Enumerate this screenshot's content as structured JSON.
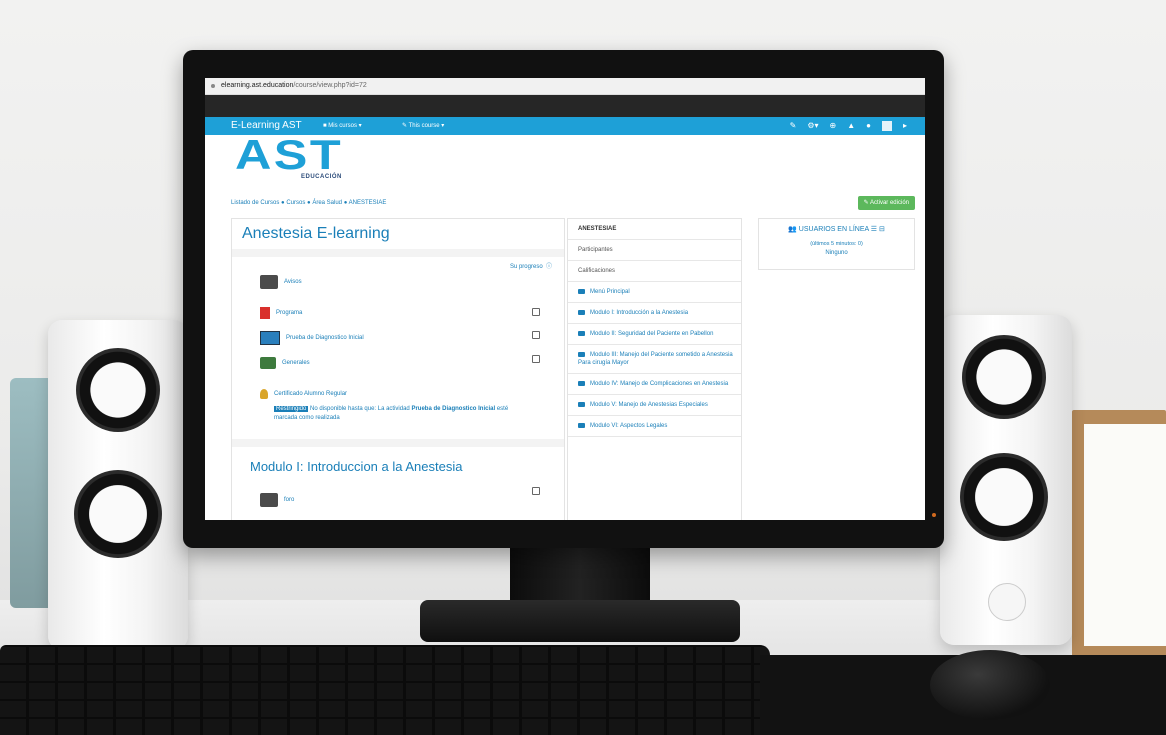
{
  "browser": {
    "url_host": "elearning.ast.education",
    "url_path": "/course/view.php?id=72"
  },
  "navbar": {
    "brand": "E-Learning AST",
    "menu_my_courses": "Mis cursos",
    "menu_this_course": "This course",
    "icons": [
      "edit-icon",
      "settings-icon",
      "globe-icon",
      "bell-icon",
      "chat-icon",
      "avatar",
      "caret-icon"
    ]
  },
  "logo": {
    "text": "AST",
    "sub": "EDUCACIÓN"
  },
  "breadcrumb": [
    "Listado de Cursos",
    "Cursos",
    "Área Salud",
    "ANESTESIAE"
  ],
  "edit_button": "Activar edición",
  "course": {
    "title": "Anestesia E-learning",
    "progress_label": "Su progreso",
    "activities": [
      {
        "label": "Avisos",
        "icon": "forum-icon",
        "checkbox": false
      },
      {
        "label": "Programa",
        "icon": "pdf-icon",
        "checkbox": true
      },
      {
        "label": "Prueba de Diagnostico Inicial",
        "icon": "quiz-icon",
        "checkbox": true
      },
      {
        "label": "Generales",
        "icon": "forum-icon",
        "checkbox": true
      },
      {
        "label": "Certificado Alumno Regular",
        "icon": "certificate-icon",
        "checkbox": false
      }
    ],
    "restriction": {
      "tag": "Restringido",
      "pre": "No disponible hasta que: La actividad",
      "bold": "Prueba de Diagnostico Inicial",
      "post": "esté marcada como realizada"
    },
    "section2_title": "Modulo I: Introduccion a la Anestesia",
    "section2_first": "foro"
  },
  "nav_block": {
    "header": "ANESTESIAE",
    "items": [
      "Participantes",
      "Calificaciones"
    ],
    "modules": [
      "Menú Principal",
      "Modulo I: Introducción a la Anestesia",
      "Modulo II: Seguridad del Paciente en Pabellon",
      "Modulo III: Manejo del Paciente sometido a Anestesia Para cirugía Mayor",
      "Modulo IV: Manejo de Complicaciones en Anestesia",
      "Modulo V: Manejo de Anestesias Especiales",
      "Modulo VI: Aspectos Legales"
    ]
  },
  "online_users": {
    "title": "USUARIOS EN LÍNEA",
    "subtitle": "(últimos 5 minutos: 0)",
    "none": "Ninguno"
  }
}
